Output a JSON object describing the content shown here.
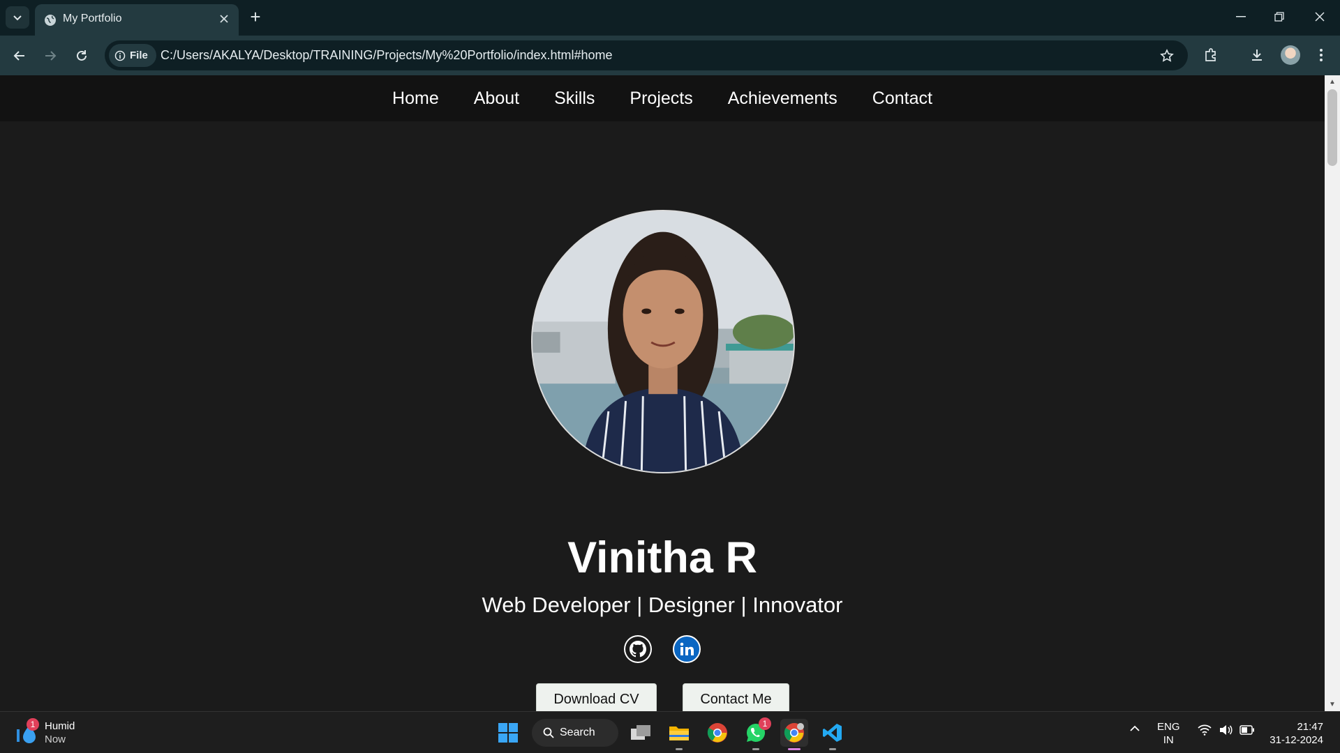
{
  "browser": {
    "tab_title": "My Portfolio",
    "new_tab_symbol": "+",
    "site_chip_label": "File",
    "url": "C:/Users/AKALYA/Desktop/TRAINING/Projects/My%20Portfolio/index.html#home"
  },
  "nav": {
    "items": [
      "Home",
      "About",
      "Skills",
      "Projects",
      "Achievements",
      "Contact"
    ]
  },
  "hero": {
    "name": "Vinitha R",
    "tagline": "Web Developer | Designer | Innovator",
    "buttons": {
      "download_cv": "Download CV",
      "contact_me": "Contact Me"
    },
    "social": [
      "github-icon",
      "linkedin-icon"
    ]
  },
  "taskbar": {
    "weather": {
      "title": "Humid",
      "subtitle": "Now",
      "badge": "1"
    },
    "search_label": "Search",
    "whatsapp_badge": "1",
    "lang": {
      "line1": "ENG",
      "line2": "IN"
    },
    "clock": {
      "time": "21:47",
      "date": "31-12-2024"
    }
  },
  "colors": {
    "page_bg": "#1b1b1b",
    "nav_bg": "#121212",
    "button_bg": "#eef2ee",
    "linkedin_blue": "#0a66c2"
  }
}
